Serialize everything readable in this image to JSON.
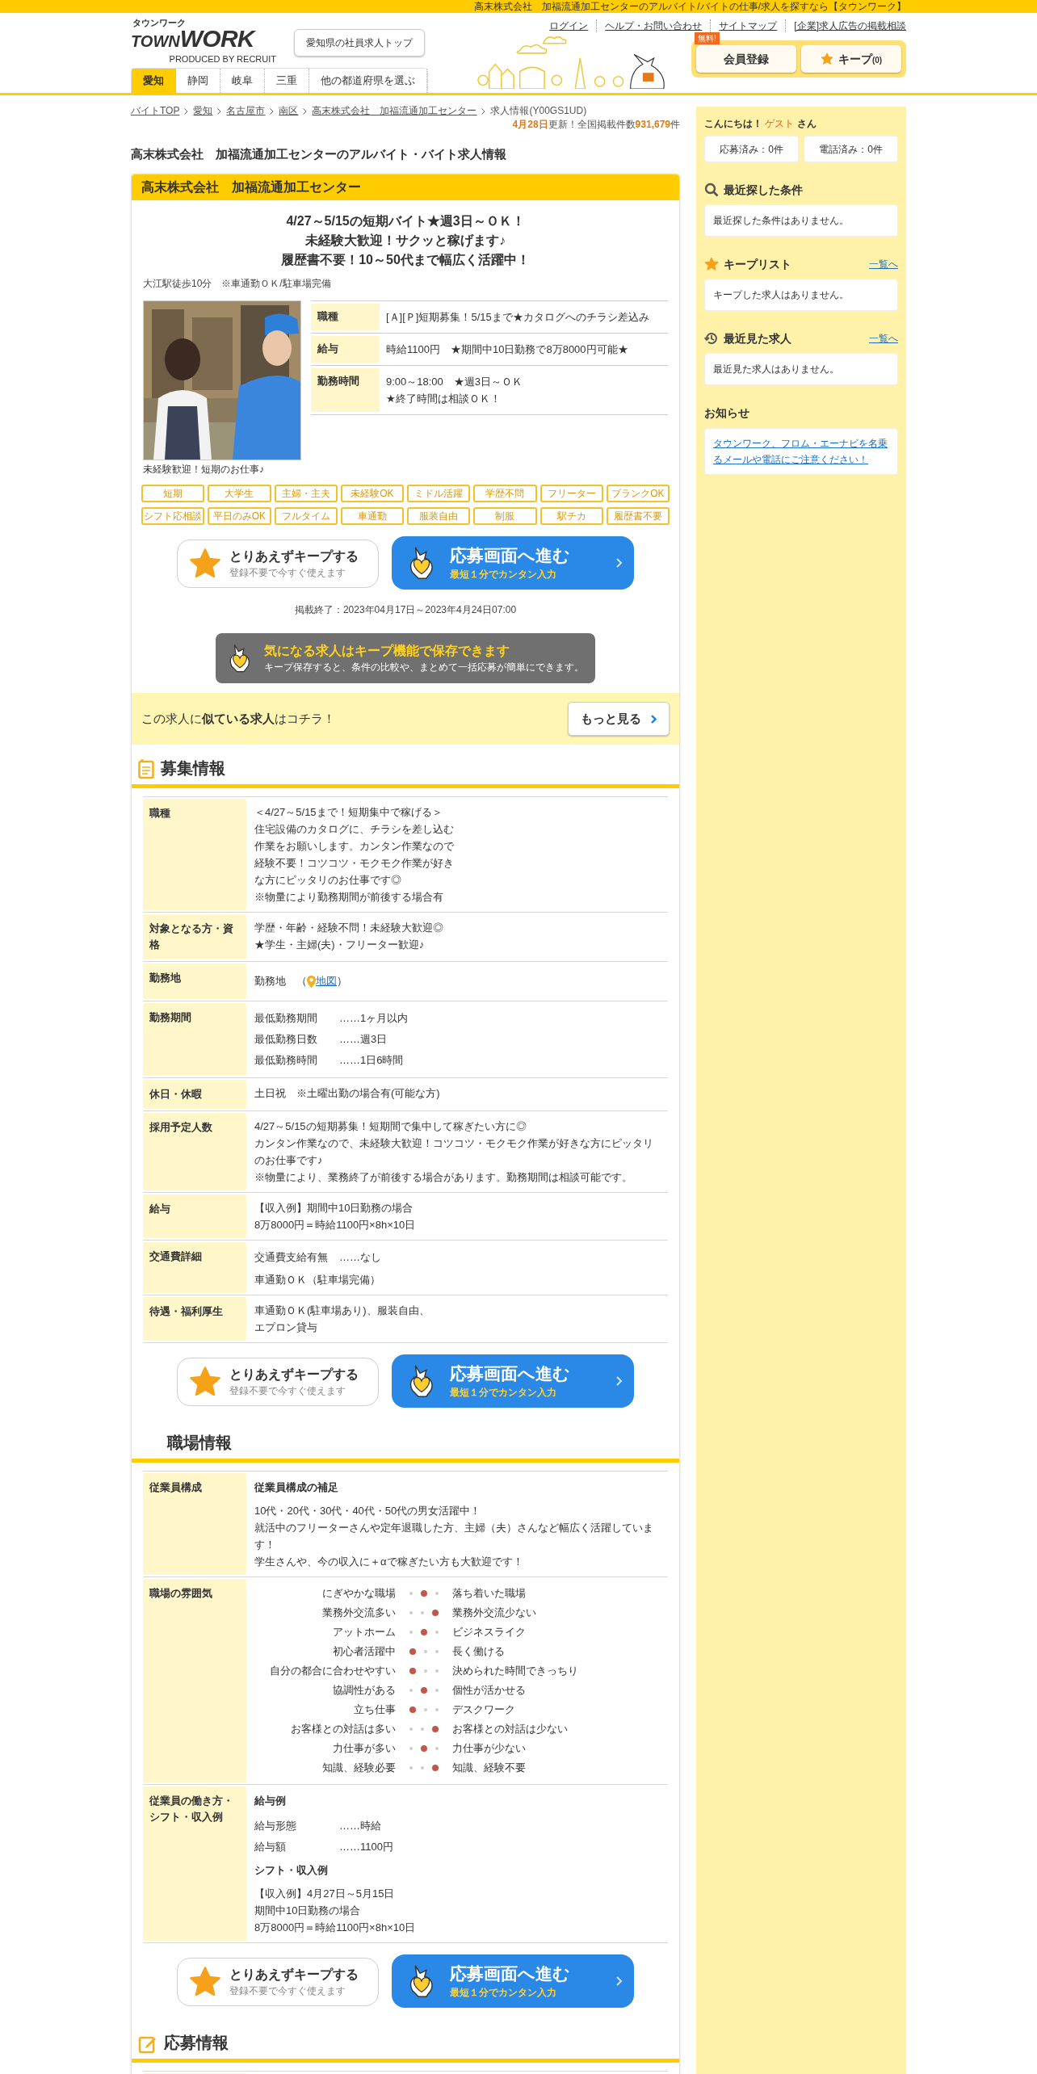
{
  "top_strip": "高末株式会社　加福流通加工センターのアルバイト/バイトの仕事/求人を探すなら【タウンワーク】",
  "logo": {
    "kana": "タウンワーク",
    "town": "TOWN",
    "work": "WORK",
    "credit": "PRODUCED BY RECRUIT"
  },
  "top_button": "愛知県の社員求人トップ",
  "links": [
    "ログイン",
    "ヘルプ・お問い合わせ",
    "サイトマップ",
    "[企業]求人広告の掲載相談"
  ],
  "tabs": [
    {
      "label": "愛知",
      "selected": true
    },
    {
      "label": "静岡",
      "selected": false
    },
    {
      "label": "岐阜",
      "selected": false
    },
    {
      "label": "三重",
      "selected": false
    },
    {
      "label": "他の都道府県を選ぶ",
      "selected": false
    }
  ],
  "member": {
    "badge": "無料!",
    "register": "会員登録",
    "keep": "キープ",
    "keep_count": "(0)"
  },
  "breadcrumb": [
    "バイトTOP",
    "愛知",
    "名古屋市",
    "南区",
    "高末株式会社　加福流通加工センター"
  ],
  "breadcrumb_current": "求人情報(Y00GS1UD)",
  "update": "**4月28日**更新！全国掲載件数**931,679**件",
  "page_title": "高末株式会社　加福流通加工センターのアルバイト・バイト求人情報",
  "company": "高末株式会社　加福流通加工センター",
  "catch": [
    "4/27～5/15の短期バイト★週3日～ＯＫ！",
    "未経験大歓迎！サクッと稼げます♪",
    "履歴書不要！10～50代まで幅広く活躍中！"
  ],
  "access": "大江駅徒歩10分　※車通勤ＯＫ/駐車場完備",
  "photo": {
    "kind": "picture",
    "caption": "未経験歓迎！短期のお仕事♪"
  },
  "summary": [
    {
      "label": "職種",
      "text": "[Ａ][Ｐ]短期募集！5/15まで★カタログへのチラシ差込み"
    },
    {
      "label": "給与",
      "text": "時給1100円　★期間中10日勤務で8万8000円可能★"
    },
    {
      "label": "勤務時間",
      "text": "9:00～18:00　★週3日～ＯＫ\n★終了時間は相談ＯＫ！"
    }
  ],
  "tags": [
    "短期",
    "大学生",
    "主婦・主夫",
    "未経験OK",
    "ミドル活躍",
    "学歴不問",
    "フリーター",
    "ブランクOK",
    "シフト応相談",
    "平日のみOK",
    "フルタイム",
    "車通勤",
    "服装自由",
    "制服",
    "駅チカ",
    "履歴書不要"
  ],
  "actions_top": {
    "keep": "とりあえずキープする",
    "keep_sub": "登録不要で今すぐ使えます",
    "apply": "応募画面へ進む",
    "apply_sub": "最短１分でカンタン入力"
  },
  "period": "掲載終了：2023年04月17日～2023年4月24日07:00",
  "banner": {
    "title": "気になる求人はキープ機能で保存できます",
    "sub": "キープ保存すると、条件の比較や、まとめて一括応募が簡単にできます。"
  },
  "similar": {
    "text": "この求人に**似ている求人**はコチラ！",
    "button": "もっと見る"
  },
  "recruit": {
    "title": "募集情報",
    "rows": [
      {
        "label": "職種",
        "blocks": [
          {
            "kind": "text",
            "lines": [
              "＜4/27～5/15まで！短期集中で稼げる＞",
              "住宅設備のカタログに、チラシを差し込む",
              "作業をお願いします。カンタン作業なので",
              "経験不要！コツコツ・モクモク作業が好き",
              "な方にピッタリのお仕事です◎",
              "※物量により勤務期間が前後する場合有"
            ]
          }
        ]
      },
      {
        "label": "対象となる方・資格",
        "blocks": [
          {
            "kind": "text",
            "lines": [
              "学歴・年齢・経験不問！未経験大歓迎◎",
              "★学生・主婦(夫)・フリーター歓迎♪"
            ]
          }
        ]
      },
      {
        "label": "勤務地",
        "blocks": [
          {
            "kind": "map",
            "text": "勤務地　（",
            "link": "地図",
            "close": "）"
          }
        ]
      },
      {
        "label": "勤務期間",
        "blocks": [
          {
            "kind": "pairs",
            "pairs": [
              {
                "name": "最低勤務期間",
                "value": "……1ヶ月以内"
              },
              {
                "name": "最低勤務日数",
                "value": "……週3日"
              },
              {
                "name": "最低勤務時間",
                "value": "……1日6時間"
              }
            ]
          }
        ]
      },
      {
        "label": "休日・休暇",
        "blocks": [
          {
            "kind": "text",
            "lines": [
              "土日祝　※土曜出勤の場合有(可能な方)"
            ]
          }
        ]
      },
      {
        "label": "採用予定人数",
        "blocks": [
          {
            "kind": "text",
            "lines": [
              "4/27～5/15の短期募集！短期間で集中して稼ぎたい方に◎",
              "カンタン作業なので、未経験大歓迎！コツコツ・モクモク作業が好きな方にピッタリのお仕事です♪",
              "※物量により、業務終了が前後する場合があります。勤務期間は相談可能です。"
            ]
          }
        ]
      },
      {
        "label": "給与",
        "blocks": [
          {
            "kind": "text",
            "lines": [
              "【収入例】期間中10日勤務の場合",
              "8万8000円＝時給1100円×8h×10日"
            ]
          }
        ]
      },
      {
        "label": "交通費詳細",
        "blocks": [
          {
            "kind": "pairs",
            "pairs": [
              {
                "name": "交通費支給有無",
                "value": "……なし"
              }
            ]
          },
          {
            "kind": "text",
            "lines": [
              "車通勤ＯＫ（駐車場完備）"
            ]
          }
        ]
      },
      {
        "label": "待遇・福利厚生",
        "blocks": [
          {
            "kind": "text",
            "lines": [
              "車通勤ＯＫ(駐車場あり)、服装自由、",
              "エプロン貸与"
            ]
          }
        ]
      }
    ],
    "actions": {
      "keep": "とりあえずキープする",
      "keep_sub": "登録不要で今すぐ使えます",
      "apply": "応募画面へ進む",
      "apply_sub": "最短１分でカンタン入力"
    }
  },
  "workplace": {
    "title": "職場情報",
    "rows": [
      {
        "label": "従業員構成",
        "blocks": [
          {
            "kind": "heading",
            "text": "従業員構成の補足"
          },
          {
            "kind": "text",
            "lines": [
              "10代・20代・30代・40代・50代の男女活躍中！",
              "就活中のフリーターさんや定年退職した方、主婦（夫）さんなど幅広く活躍しています！",
              "学生さんや、今の収入に＋αで稼ぎたい方も大歓迎です！"
            ]
          }
        ]
      },
      {
        "label": "職場の雰囲気",
        "blocks": [
          {
            "kind": "mood",
            "rows": [
              {
                "left": "にぎやかな職場",
                "right": "落ち着いた職場",
                "dots": [
                  {
                    "selected": false
                  },
                  {
                    "selected": true
                  },
                  {
                    "selected": false
                  }
                ]
              },
              {
                "left": "業務外交流多い",
                "right": "業務外交流少ない",
                "dots": [
                  {
                    "selected": false
                  },
                  {
                    "selected": false
                  },
                  {
                    "selected": true
                  }
                ]
              },
              {
                "left": "アットホーム",
                "right": "ビジネスライク",
                "dots": [
                  {
                    "selected": false
                  },
                  {
                    "selected": true
                  },
                  {
                    "selected": false
                  }
                ]
              },
              {
                "left": "初心者活躍中",
                "right": "長く働ける",
                "dots": [
                  {
                    "selected": true
                  },
                  {
                    "selected": false
                  },
                  {
                    "selected": false
                  }
                ]
              },
              {
                "left": "自分の都合に合わせやすい",
                "right": "決められた時間できっちり",
                "dots": [
                  {
                    "selected": true
                  },
                  {
                    "selected": false
                  },
                  {
                    "selected": false
                  }
                ]
              },
              {
                "left": "協調性がある",
                "right": "個性が活かせる",
                "dots": [
                  {
                    "selected": false
                  },
                  {
                    "selected": true
                  },
                  {
                    "selected": false
                  }
                ]
              },
              {
                "left": "立ち仕事",
                "right": "デスクワーク",
                "dots": [
                  {
                    "selected": true
                  },
                  {
                    "selected": false
                  },
                  {
                    "selected": false
                  }
                ]
              },
              {
                "left": "お客様との対話は多い",
                "right": "お客様との対話は少ない",
                "dots": [
                  {
                    "selected": false
                  },
                  {
                    "selected": false
                  },
                  {
                    "selected": true
                  }
                ]
              },
              {
                "left": "力仕事が多い",
                "right": "力仕事が少ない",
                "dots": [
                  {
                    "selected": false
                  },
                  {
                    "selected": true
                  },
                  {
                    "selected": false
                  }
                ]
              },
              {
                "left": "知識、経験必要",
                "right": "知識、経験不要",
                "dots": [
                  {
                    "selected": false
                  },
                  {
                    "selected": false
                  },
                  {
                    "selected": true
                  }
                ]
              }
            ]
          }
        ]
      },
      {
        "label": "従業員の働き方・シフト・収入例",
        "blocks": [
          {
            "kind": "heading",
            "text": "給与例"
          },
          {
            "kind": "pairs",
            "pairs": [
              {
                "name": "給与形態",
                "value": "……時給"
              },
              {
                "name": "給与額",
                "value": "……1100円"
              }
            ]
          },
          {
            "kind": "heading",
            "text": "シフト・収入例"
          },
          {
            "kind": "text",
            "lines": [
              "【収入例】4月27日～5月15日",
              "期間中10日勤務の場合",
              "8万8000円＝時給1100円×8h×10日"
            ]
          }
        ]
      }
    ],
    "actions": {
      "keep": "とりあえずキープする",
      "keep_sub": "登録不要で今すぐ使えます",
      "apply": "応募画面へ進む",
      "apply_sub": "最短１分でカンタン入力"
    }
  },
  "apply_section": {
    "title": "応募情報"
  },
  "sidebar": {
    "greeting": {
      "before": "こんにちは！",
      "name": "ゲスト",
      "after": "さん"
    },
    "counters": [
      "応募済み：0件",
      "電話済み：0件"
    ],
    "panels": [
      {
        "kind": "search",
        "title": "最近探した条件",
        "text": "最近探した条件はありません。"
      },
      {
        "kind": "keep",
        "title": "キープリスト",
        "link": "一覧へ",
        "text": "キープした求人はありません。"
      },
      {
        "kind": "history",
        "title": "最近見た求人",
        "link": "一覧へ",
        "text": "最近見た求人はありません。"
      }
    ],
    "notice": {
      "title": "お知らせ",
      "link": "タウンワーク、フロム・エーナビを名乗るメールや電話にご注意ください！"
    }
  }
}
